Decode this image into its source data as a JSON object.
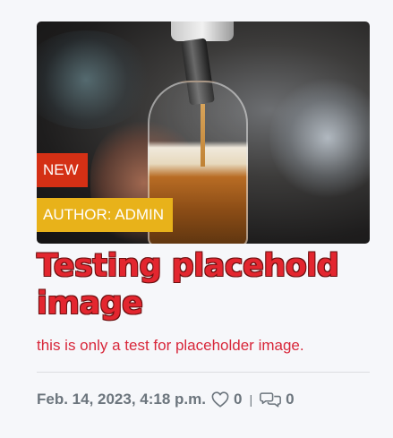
{
  "post": {
    "badge_new": "NEW",
    "badge_author": "AUTHOR: ADMIN",
    "title": "Testing placehold image",
    "excerpt": "this is only a test for placeholder image.",
    "date": "Feb. 14, 2023, 4:18 p.m.",
    "likes": "0",
    "separator": "|",
    "comments": "0"
  },
  "icons": {
    "like": "heart-outline-icon",
    "comments": "chat-bubbles-icon"
  },
  "colors": {
    "title": "#e3262f",
    "excerpt": "#d8273a",
    "badge_new": "#d43015",
    "badge_author": "#e8b21a",
    "meta": "#6c757d"
  }
}
